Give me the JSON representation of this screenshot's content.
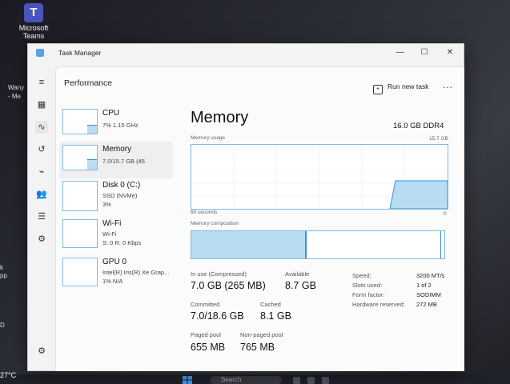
{
  "desktop": {
    "teams_label_1": "Microsoft",
    "teams_label_2": "Teams",
    "side_text_1": "Wany",
    "side_text_2": "- Me",
    "left_text_1": "k",
    "left_text_2": "pp",
    "left_text_3": "D",
    "temperature": "27°C",
    "search_placeholder": "Search"
  },
  "window": {
    "title": "Task Manager",
    "minimize": "—",
    "maximize": "☐",
    "close": "✕"
  },
  "header": {
    "title": "Performance",
    "run_new_task": "Run new task",
    "more": "..."
  },
  "perf_list": [
    {
      "name": "CPU",
      "sub1": "7%  1.15 GHz",
      "sub2": "",
      "fill": 0.07
    },
    {
      "name": "Memory",
      "sub1": "7.0/15.7 GB (45",
      "sub2": "",
      "fill": 0.45
    },
    {
      "name": "Disk 0 (C:)",
      "sub1": "SSD (NVMe)",
      "sub2": "3%",
      "fill": 0.03
    },
    {
      "name": "Wi-Fi",
      "sub1": "Wi-Fi",
      "sub2": "S: 0  R: 0 Kbps",
      "fill": 0.0
    },
    {
      "name": "GPU 0",
      "sub1": "Intel(R) Iris(R) Xe Grap...",
      "sub2": "1% N/A",
      "fill": 0.01
    }
  ],
  "memory": {
    "title": "Memory",
    "capacity": "16.0 GB DDR4",
    "usage_label": "Memory usage",
    "usage_max": "15.7 GB",
    "time_label": "60 seconds",
    "time_end": "0",
    "composition_label": "Memory composition",
    "usage_fraction": 0.45,
    "in_use_label": "In use (Compressed)",
    "in_use_value": "7.0 GB (265 MB)",
    "available_label": "Available",
    "available_value": "8.7 GB",
    "committed_label": "Committed",
    "committed_value": "7.0/18.6 GB",
    "cached_label": "Cached",
    "cached_value": "8.1 GB",
    "paged_label": "Paged pool",
    "paged_value": "655 MB",
    "nonpaged_label": "Non-paged pool",
    "nonpaged_value": "765 MB",
    "specs": [
      {
        "label": "Speed:",
        "value": "3200 MT/s"
      },
      {
        "label": "Slots used:",
        "value": "1 of 2"
      },
      {
        "label": "Form factor:",
        "value": "SODIMM"
      },
      {
        "label": "Hardware reserved:",
        "value": "272 MB"
      }
    ]
  },
  "colors": {
    "accent": "#3a8fd0",
    "fill": "#b9dcf5"
  }
}
